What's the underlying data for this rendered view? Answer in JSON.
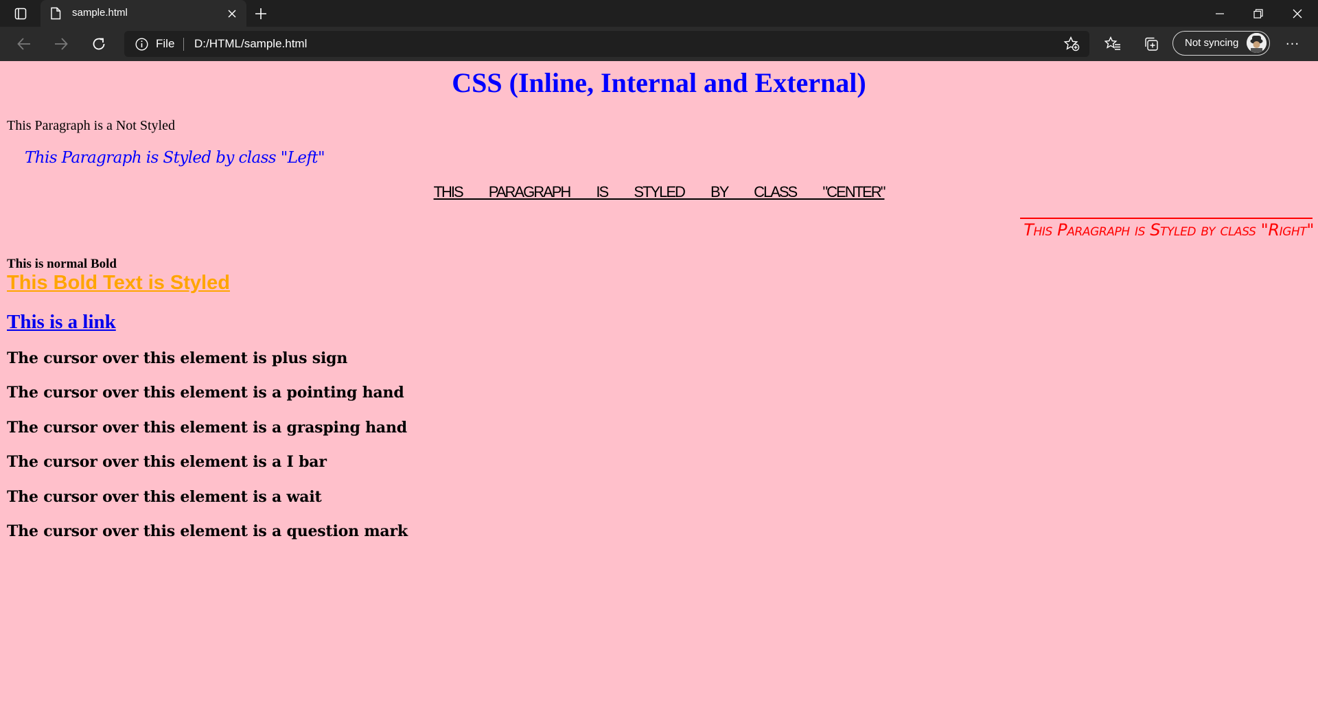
{
  "browser": {
    "tab_title": "sample.html",
    "address_scheme": "File",
    "address_url": "D:/HTML/sample.html",
    "sync_label": "Not syncing",
    "colors": {
      "tabbar": "#1f1f1f",
      "toolbar": "#2b2b2b",
      "address_bg": "#1f1f1f"
    },
    "icons": [
      "sidebar-icon",
      "file-icon",
      "close-icon",
      "plus-icon",
      "minimize-icon",
      "restore-icon",
      "back-icon",
      "forward-icon",
      "refresh-icon",
      "info-icon",
      "star-add-icon",
      "favorites-icon",
      "collections-icon",
      "avatar",
      "more-icon"
    ]
  },
  "page": {
    "background": "#ffc0cb",
    "heading": "CSS (Inline, Internal and External)",
    "p_not_styled": "This Paragraph is a Not Styled",
    "p_left": "This Paragraph is Styled by class \"Left\"",
    "p_center": "THIS PARAGRAPH IS STYLED BY CLASS \"CENTER\"",
    "p_right": "This Paragraph is Styled by class \"Right\"",
    "bold_normal": "This is normal Bold",
    "bold_styled": "This Bold Text is Styled",
    "link": "This is a link",
    "cursor_lines": [
      "The cursor over this element is plus sign",
      "The cursor over this element is a pointing hand",
      "The cursor over this element is a grasping hand",
      "The cursor over this element is a I bar",
      "The cursor over this element is a wait",
      "The cursor over this element is a question mark"
    ],
    "colors": {
      "heading": "#0000ff",
      "left": "#0000ff",
      "right": "#ff0000",
      "bold_styled": "#ffa500",
      "link": "#0000ee"
    }
  }
}
